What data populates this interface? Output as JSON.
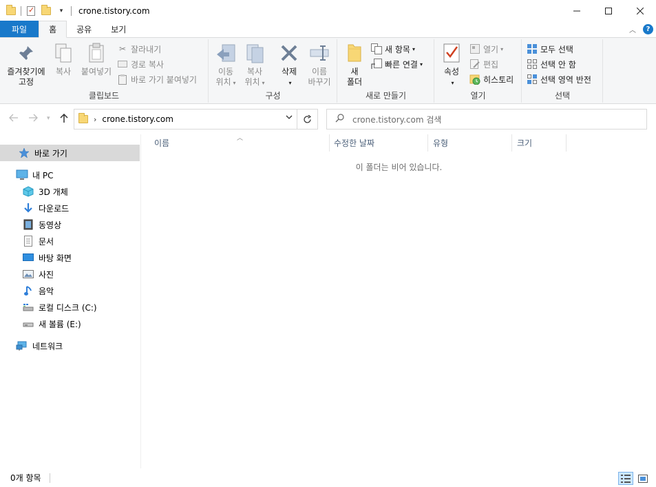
{
  "window": {
    "title": "crone.tistory.com",
    "controls": [
      "minimize",
      "maximize",
      "close"
    ]
  },
  "ribbon_tabs": [
    {
      "label": "파일"
    },
    {
      "label": "홈"
    },
    {
      "label": "공유"
    },
    {
      "label": "보기"
    }
  ],
  "ribbon": {
    "clipboard": {
      "label": "클립보드",
      "pin_label_1": "즐겨찾기에",
      "pin_label_2": "고정",
      "copy": "복사",
      "paste": "붙여넣기",
      "cut": "잘라내기",
      "copy_path": "경로 복사",
      "paste_shortcut": "바로 가기 붙여넣기"
    },
    "organize": {
      "label": "구성",
      "move_1": "이동",
      "move_2": "위치",
      "copy_1": "복사",
      "copy_2": "위치",
      "delete": "삭제",
      "rename_1": "이름",
      "rename_2": "바꾸기"
    },
    "new": {
      "label": "새로 만들기",
      "folder_1": "새",
      "folder_2": "폴더",
      "new_item": "새 항목",
      "easy_access": "빠른 연결"
    },
    "open": {
      "label": "열기",
      "properties": "속성",
      "open": "열기",
      "edit": "편집",
      "history": "히스토리"
    },
    "select": {
      "label": "선택",
      "select_all": "모두 선택",
      "select_none": "선택 안 함",
      "invert": "선택 영역 반전"
    }
  },
  "address": {
    "path": "crone.tistory.com",
    "search_placeholder": "crone.tistory.com 검색"
  },
  "nav_pane": {
    "quick_access": "바로 가기",
    "this_pc": "내 PC",
    "items": [
      {
        "label": "3D 개체",
        "icon": "3d-objects-icon"
      },
      {
        "label": "다운로드",
        "icon": "downloads-icon"
      },
      {
        "label": "동영상",
        "icon": "videos-icon"
      },
      {
        "label": "문서",
        "icon": "documents-icon"
      },
      {
        "label": "바탕 화면",
        "icon": "desktop-icon"
      },
      {
        "label": "사진",
        "icon": "pictures-icon"
      },
      {
        "label": "음악",
        "icon": "music-icon"
      },
      {
        "label": "로컬 디스크 (C:)",
        "icon": "local-disk-icon"
      },
      {
        "label": "새 볼륨 (E:)",
        "icon": "volume-icon"
      }
    ],
    "network": "네트워크"
  },
  "columns": [
    {
      "label": "이름"
    },
    {
      "label": "수정한 날짜"
    },
    {
      "label": "유형"
    },
    {
      "label": "크기"
    }
  ],
  "empty_message": "이 폴더는 비어 있습니다.",
  "status": {
    "item_count": "0개 항목"
  },
  "colors": {
    "accent": "#1979ca",
    "ribbon_bg": "#f5f6f7",
    "selected_nav": "#d9d9d9",
    "column_header_text": "#4c607a"
  }
}
